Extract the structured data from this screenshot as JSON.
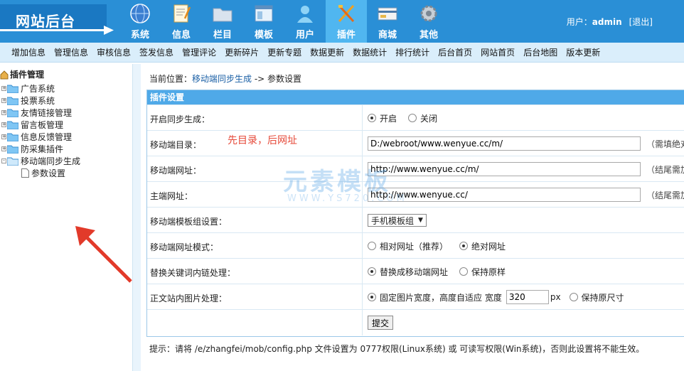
{
  "header": {
    "logo": "网站后台",
    "nav": [
      {
        "label": "系统",
        "icon": "globe-icon"
      },
      {
        "label": "信息",
        "icon": "document-icon"
      },
      {
        "label": "栏目",
        "icon": "folder-icon"
      },
      {
        "label": "模板",
        "icon": "window-icon"
      },
      {
        "label": "用户",
        "icon": "user-icon"
      },
      {
        "label": "插件",
        "icon": "tools-icon"
      },
      {
        "label": "商城",
        "icon": "card-icon"
      },
      {
        "label": "其他",
        "icon": "gear-icon"
      }
    ],
    "user_prefix": "用户：",
    "username": "admin",
    "logout": "[退出]"
  },
  "submenu": [
    "增加信息",
    "管理信息",
    "审核信息",
    "签发信息",
    "管理评论",
    "更新碎片",
    "更新专题",
    "数据更新",
    "数据统计",
    "排行统计",
    "后台首页",
    "网站首页",
    "后台地图",
    "版本更新"
  ],
  "tree": {
    "root": "插件管理",
    "items": [
      "广告系统",
      "投票系统",
      "友情链接管理",
      "留言板管理",
      "信息反馈管理",
      "防采集插件",
      "移动端同步生成"
    ],
    "sub_item": "参数设置"
  },
  "breadcrumb": {
    "prefix": "当前位置：",
    "link": "移动端同步生成",
    "sep": " -> ",
    "current": "参数设置"
  },
  "panel": {
    "title": "插件设置",
    "sync": {
      "label": "开启同步生成：",
      "on": "开启",
      "off": "关闭"
    },
    "mobile_dir": {
      "label": "移动端目录：",
      "value": "D:/webroot/www.wenyue.cc/m/",
      "hint": "（需填绝对"
    },
    "mobile_url": {
      "label": "移动端网址：",
      "value": "http://www.wenyue.cc/m/",
      "hint": "（结尾需加"
    },
    "main_url": {
      "label": "主端网址：",
      "value": "http://www.wenyue.cc/",
      "hint": "（结尾需加"
    },
    "template": {
      "label": "移动端模板组设置：",
      "value": "手机模板组"
    },
    "url_mode": {
      "label": "移动端网址模式：",
      "relative": "相对网址（推荐）",
      "absolute": "绝对网址"
    },
    "keyword": {
      "label": "替换关键词内链处理：",
      "replace": "替换成移动端网址",
      "keep": "保持原样"
    },
    "image": {
      "label": "正文站内图片处理：",
      "fixed": "固定图片宽度，高度自适应 宽度",
      "width": "320",
      "unit": "px",
      "keep": "保持原尺寸"
    },
    "submit": "提交"
  },
  "note": "提示：请将 /e/zhangfei/mob/config.php 文件设置为 0777权限(Linux系统) 或 可读写权限(Win系统)，否则此设置将不能生效。",
  "annotation": "先目录，后网址",
  "watermark": "元素模板",
  "watermark_sub": "WWW.YS720.COM",
  "colors": {
    "header": "#2a8fd6",
    "active_nav": "#50b6f0",
    "submenu": "#daeefb",
    "panel_head": "#4fa9e8",
    "annotation": "#e64a3a"
  }
}
